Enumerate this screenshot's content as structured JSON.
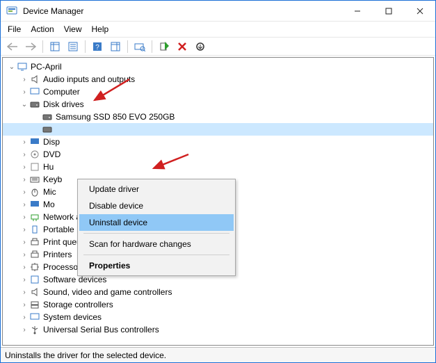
{
  "window": {
    "title": "Device Manager"
  },
  "menu": {
    "file": "File",
    "action": "Action",
    "view": "View",
    "help": "Help"
  },
  "tree": {
    "root": "PC-April",
    "audio": "Audio inputs and outputs",
    "computer": "Computer",
    "disk_drives": "Disk drives",
    "disk_child1": "Samsung SSD 850 EVO 250GB",
    "display": "Disp",
    "dvd": "DVD",
    "hid": "Hu",
    "keyboards": "Keyb",
    "mice": "Mic",
    "monitors": "Mo",
    "network": "Network adapters",
    "portable": "Portable Devices",
    "printqueues": "Print queues",
    "printers": "Printers",
    "processors": "Processors",
    "software": "Software devices",
    "sound": "Sound, video and game controllers",
    "storage": "Storage controllers",
    "system": "System devices",
    "usb": "Universal Serial Bus controllers"
  },
  "context_menu": {
    "update": "Update driver",
    "disable": "Disable device",
    "uninstall": "Uninstall device",
    "scan": "Scan for hardware changes",
    "properties": "Properties"
  },
  "statusbar": {
    "text": "Uninstalls the driver for the selected device."
  }
}
